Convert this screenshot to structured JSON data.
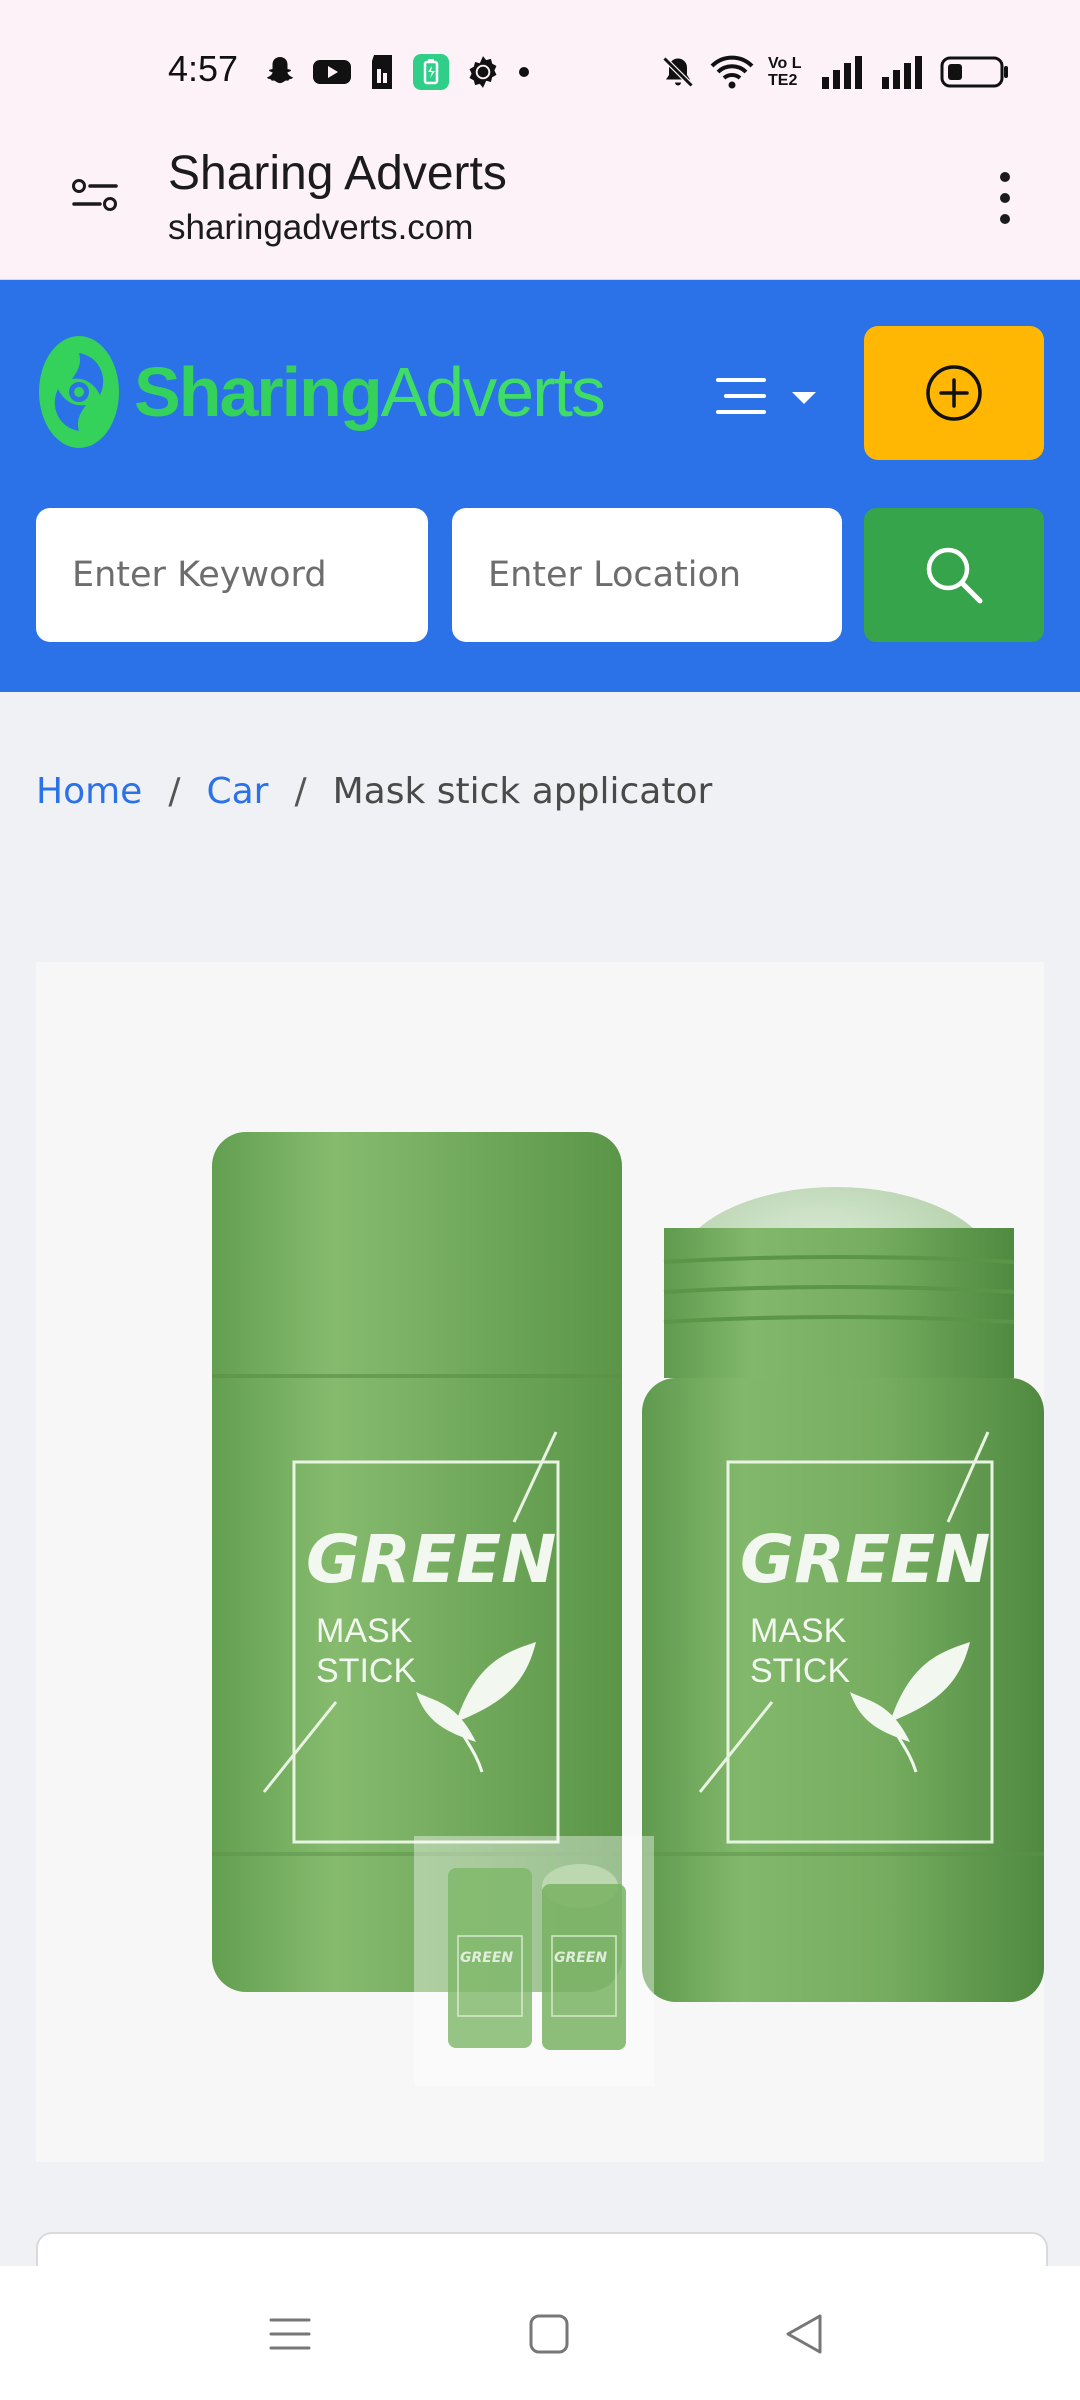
{
  "status_bar": {
    "time": "4:57",
    "left_icons": [
      "snapchat-icon",
      "youtube-icon",
      "sim-card-icon",
      "battery-saver-icon",
      "settings-gear-icon",
      "dot-icon"
    ],
    "right_icons": [
      "mute-bell-icon",
      "wifi-icon",
      "volte-icon",
      "signal-icon",
      "signal-icon",
      "battery-icon"
    ],
    "volte_label": "Vo LTE2"
  },
  "browser": {
    "title": "Sharing Adverts",
    "url": "sharingadverts.com"
  },
  "site": {
    "logo_bold": "Sharing",
    "logo_light": "Adverts",
    "search": {
      "keyword_placeholder": "Enter Keyword",
      "location_placeholder": "Enter Location"
    },
    "colors": {
      "header": "#2b72e8",
      "post_ad_button": "#ffb703",
      "search_button": "#36a44a",
      "logo": "#34d25a"
    }
  },
  "breadcrumb": {
    "items": [
      {
        "label": "Home"
      },
      {
        "label": "Car"
      }
    ],
    "separator": "/",
    "current": "Mask stick applicator"
  },
  "product_image": {
    "brand": "GREEN",
    "line1": "MASK",
    "line2": "STICK"
  }
}
